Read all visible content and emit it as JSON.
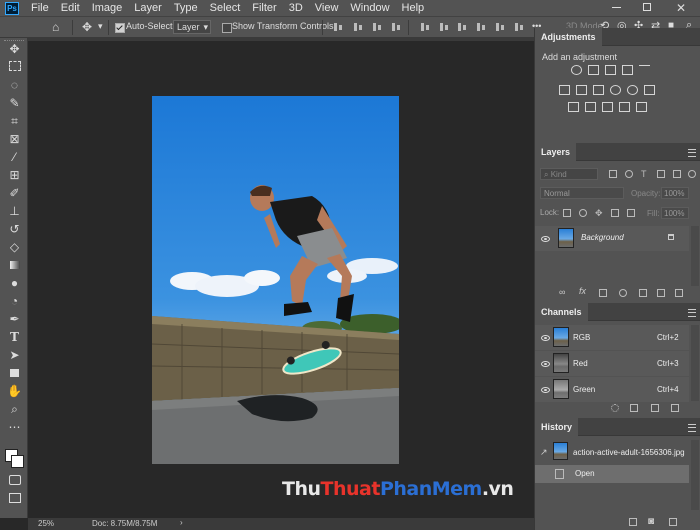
{
  "app": {
    "logo": "Ps"
  },
  "menu": [
    "File",
    "Edit",
    "Image",
    "Layer",
    "Type",
    "Select",
    "Filter",
    "3D",
    "View",
    "Window",
    "Help"
  ],
  "options_bar": {
    "auto_select_label": "Auto-Select:",
    "auto_select_checked": true,
    "auto_select_target": "Layer",
    "transform_label": "Show Transform Controls",
    "transform_checked": false,
    "mode_3d_label": "3D Mode:"
  },
  "tools": [
    "move-tool",
    "marquee-tool",
    "lasso-tool",
    "quick-select-tool",
    "crop-tool",
    "frame-tool",
    "eyedropper-tool",
    "healing-brush-tool",
    "brush-tool",
    "clone-stamp-tool",
    "history-brush-tool",
    "eraser-tool",
    "gradient-tool",
    "blur-tool",
    "dodge-tool",
    "pen-tool",
    "type-tool",
    "path-select-tool",
    "shape-tool",
    "hand-tool",
    "zoom-tool",
    "more-tools"
  ],
  "colors": {
    "foreground": "#ffffff",
    "background": "#ffffff",
    "accent": "#31a8ff"
  },
  "adjustments": {
    "tab": "Adjustments",
    "add_label": "Add an adjustment"
  },
  "layers": {
    "tab": "Layers",
    "filter_placeholder": "Kind",
    "blend_mode": "Normal",
    "opacity_label": "Opacity:",
    "opacity_value": "100%",
    "lock_label": "Lock:",
    "fill_label": "Fill:",
    "fill_value": "100%",
    "items": [
      {
        "name": "Background",
        "locked": true,
        "visible": true
      }
    ]
  },
  "channels": {
    "tab": "Channels",
    "items": [
      {
        "name": "RGB",
        "shortcut": "Ctrl+2"
      },
      {
        "name": "Red",
        "shortcut": "Ctrl+3"
      },
      {
        "name": "Green",
        "shortcut": "Ctrl+4"
      }
    ]
  },
  "history": {
    "tab": "History",
    "snapshot": "action-active-adult-1656306.jpg",
    "items": [
      {
        "name": "Open"
      }
    ]
  },
  "status": {
    "zoom": "25%",
    "doc": "Doc: 8.75M/8.75M"
  },
  "watermark": {
    "part1": "Thu",
    "part2": "Thuat",
    "part3": "PhanMem",
    "part4": ".vn"
  }
}
